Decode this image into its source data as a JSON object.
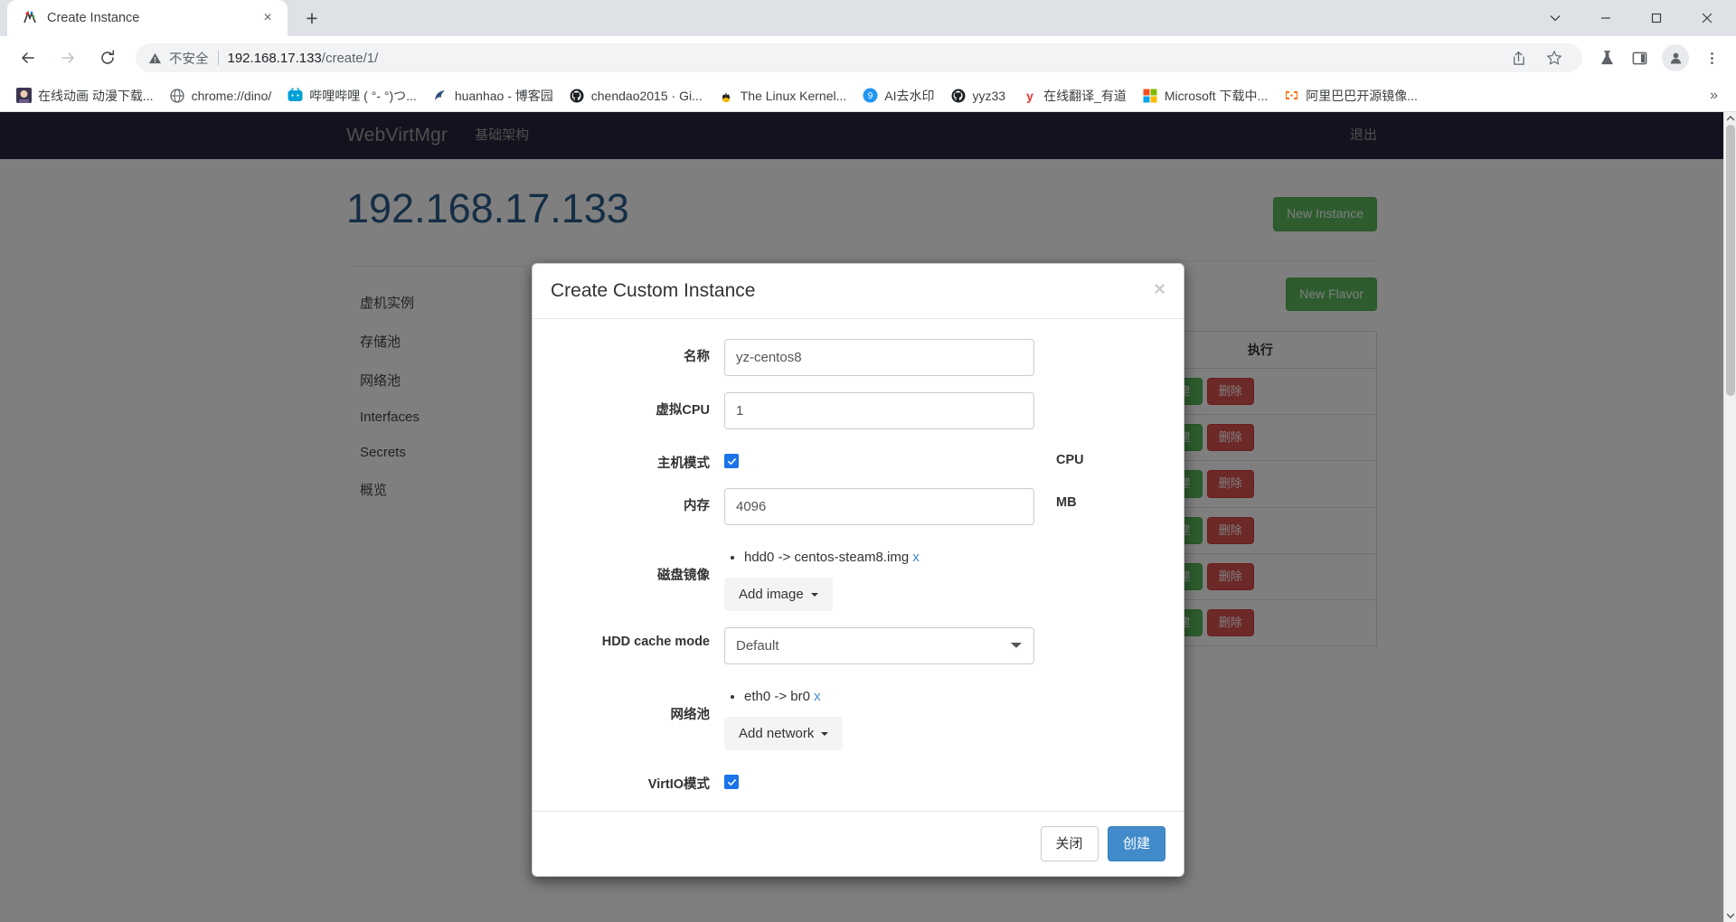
{
  "browser": {
    "tab": {
      "title": "Create Instance",
      "favicon": "webvirtmgr-favicon",
      "close_label": "×"
    },
    "new_tab_label": "+",
    "window_controls": {
      "minimize": "–",
      "maximize": "□",
      "close": "✕",
      "chevron": "∨"
    },
    "nav": {
      "back": "←",
      "forward": "→",
      "reload": "↻"
    },
    "omnibox": {
      "security_label": "不安全",
      "url_host": "192.168.17.133",
      "url_path": "/create/1/",
      "share_icon": "share-icon",
      "star_icon": "star-icon"
    },
    "toolbar_icons": [
      "flask-icon",
      "side-panel-icon",
      "profile-avatar-icon",
      "more-menu-icon"
    ],
    "bookmarks": [
      {
        "label": "在线动画 动漫下载...",
        "icon": "anime-site-icon"
      },
      {
        "label": "chrome://dino/",
        "icon": "globe-icon"
      },
      {
        "label": "哔哩哔哩 ( °- °)つ...",
        "icon": "bilibili-icon"
      },
      {
        "label": "huanhao - 博客园",
        "icon": "cnblogs-icon"
      },
      {
        "label": "chendao2015 · Gi...",
        "icon": "github-icon"
      },
      {
        "label": "The Linux Kernel...",
        "icon": "linux-tux-icon"
      },
      {
        "label": "AI去水印",
        "icon": "ai-tool-icon"
      },
      {
        "label": "yyz33",
        "icon": "github-icon"
      },
      {
        "label": "在线翻译_有道",
        "icon": "youdao-icon"
      },
      {
        "label": "Microsoft 下载中...",
        "icon": "microsoft-icon"
      },
      {
        "label": "阿里巴巴开源镜像...",
        "icon": "aliyun-mirror-icon"
      }
    ],
    "bookmarks_overflow": "»"
  },
  "site": {
    "navbar": {
      "brand": "WebVirtMgr",
      "links": [
        "基础架构"
      ],
      "right_link": "退出"
    },
    "page_title": "192.168.17.133",
    "buttons": {
      "new_instance": "New Instance",
      "new_flavor": "New Flavor"
    },
    "side_nav": [
      "虚机实例",
      "存储池",
      "网络池",
      "Interfaces",
      "Secrets",
      "概览"
    ],
    "table": {
      "headers": [
        "执行"
      ],
      "row_buttons": {
        "create": "创建",
        "delete": "删除"
      },
      "row_count": 6
    }
  },
  "modal": {
    "title": "Create Custom Instance",
    "close": "×",
    "fields": {
      "name": {
        "label": "名称",
        "value": "yz-centos8"
      },
      "vcpu": {
        "label": "虚拟CPU",
        "value": "1",
        "unit": ""
      },
      "host_model": {
        "label": "主机模式",
        "checked": true,
        "unit": "CPU"
      },
      "memory": {
        "label": "内存",
        "value": "4096",
        "unit": "MB"
      },
      "disk_image": {
        "label": "磁盘镜像",
        "items": [
          {
            "text": "hdd0 -> centos-steam8.img",
            "remove": "x"
          }
        ],
        "add_button": "Add image"
      },
      "hdd_cache": {
        "label": "HDD cache mode",
        "value": "Default"
      },
      "network_pool": {
        "label": "网络池",
        "items": [
          {
            "text": "eth0 -> br0",
            "remove": "x"
          }
        ],
        "add_button": "Add network"
      },
      "virtio": {
        "label": "VirtIO模式",
        "checked": true
      }
    },
    "footer": {
      "close": "关闭",
      "create": "创建"
    }
  },
  "colors": {
    "navbar_bg": "#2b223d",
    "title_blue": "#2b5d8a",
    "success_green": "#5cb85c",
    "danger_red": "#d9534f",
    "primary_blue": "#428bca",
    "checkbox_blue": "#1a73e8"
  }
}
